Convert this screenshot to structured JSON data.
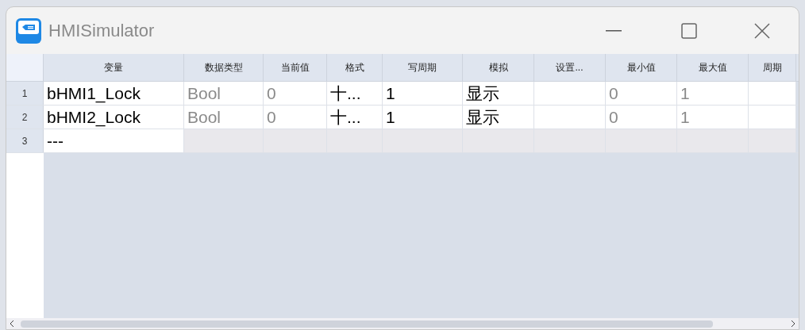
{
  "window": {
    "title": "HMISimulator"
  },
  "table": {
    "columns": [
      "变量",
      "数据类型",
      "当前值",
      "格式",
      "写周期",
      "模拟",
      "设置...",
      "最小值",
      "最大值",
      "周期"
    ],
    "rows": [
      {
        "number": "1",
        "kind": "data",
        "cells": [
          {
            "text": "bHMI1_Lock",
            "dimmed": false
          },
          {
            "text": "Bool",
            "dimmed": true
          },
          {
            "text": "0",
            "dimmed": true
          },
          {
            "text": "十...",
            "dimmed": false
          },
          {
            "text": "1",
            "dimmed": false
          },
          {
            "text": "显示",
            "dimmed": false
          },
          null,
          {
            "text": "0",
            "dimmed": true
          },
          {
            "text": "1",
            "dimmed": true
          },
          null
        ]
      },
      {
        "number": "2",
        "kind": "data",
        "cells": [
          {
            "text": "bHMI2_Lock",
            "dimmed": false
          },
          {
            "text": "Bool",
            "dimmed": true
          },
          {
            "text": "0",
            "dimmed": true
          },
          {
            "text": "十...",
            "dimmed": false
          },
          {
            "text": "1",
            "dimmed": false
          },
          {
            "text": "显示",
            "dimmed": false
          },
          null,
          {
            "text": "0",
            "dimmed": true
          },
          {
            "text": "1",
            "dimmed": true
          },
          null
        ]
      },
      {
        "number": "3",
        "kind": "new",
        "cells": [
          {
            "text": "---",
            "dimmed": false
          }
        ]
      }
    ]
  }
}
